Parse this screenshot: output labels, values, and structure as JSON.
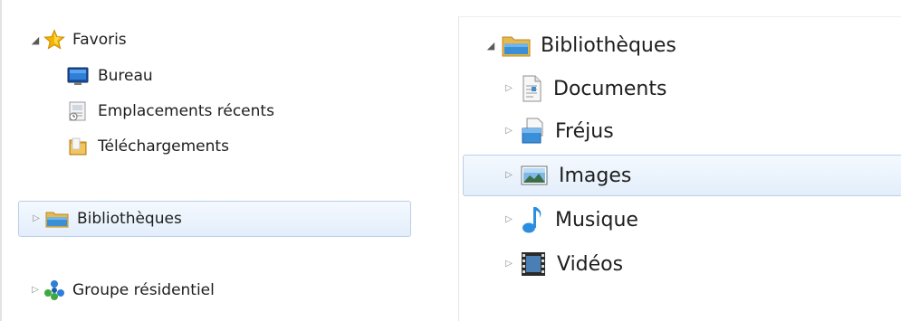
{
  "left_pane": {
    "favorites": {
      "label": "Favoris",
      "icon": "star-icon",
      "expanded": true,
      "items": [
        {
          "label": "Bureau",
          "icon": "desktop-icon"
        },
        {
          "label": "Emplacements récents",
          "icon": "recent-places-icon"
        },
        {
          "label": "Téléchargements",
          "icon": "downloads-folder-icon"
        }
      ]
    },
    "libraries": {
      "label": "Bibliothèques",
      "icon": "library-folder-icon",
      "expanded": false,
      "selected": true
    },
    "homegroup": {
      "label": "Groupe résidentiel",
      "icon": "homegroup-icon",
      "expanded": false
    }
  },
  "right_pane": {
    "libraries": {
      "label": "Bibliothèques",
      "icon": "library-folder-icon",
      "expanded": true,
      "items": [
        {
          "label": "Documents",
          "icon": "documents-icon",
          "expanded": false
        },
        {
          "label": "Fréjus",
          "icon": "library-icon",
          "expanded": false
        },
        {
          "label": "Images",
          "icon": "images-icon",
          "expanded": false,
          "selected": true
        },
        {
          "label": "Musique",
          "icon": "music-icon",
          "expanded": false
        },
        {
          "label": "Vidéos",
          "icon": "videos-icon",
          "expanded": false
        }
      ]
    }
  },
  "glyphs": {
    "expanded_arrow": "◢",
    "collapsed_arrow": "▷"
  },
  "colors": {
    "selection_fill": "#e3eefb",
    "selection_border": "#b9cfe8",
    "star": "#f5b400",
    "folder": "#e8b84a",
    "folder_blue": "#3a8fd6"
  }
}
